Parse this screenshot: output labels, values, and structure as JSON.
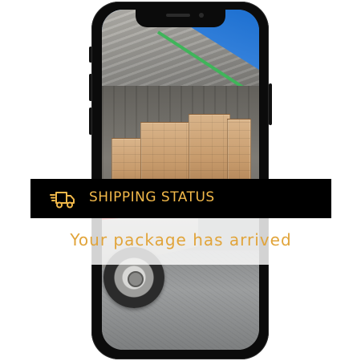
{
  "banner": {
    "label": "SHIPPING STATUS",
    "icon": "delivery-truck-icon"
  },
  "message": {
    "text": "Your package has arrived"
  },
  "colors": {
    "accent": "#f2b94a",
    "message_text": "#e1a43a",
    "banner_background": "#000000",
    "phone_body": "#0b0b0b"
  }
}
